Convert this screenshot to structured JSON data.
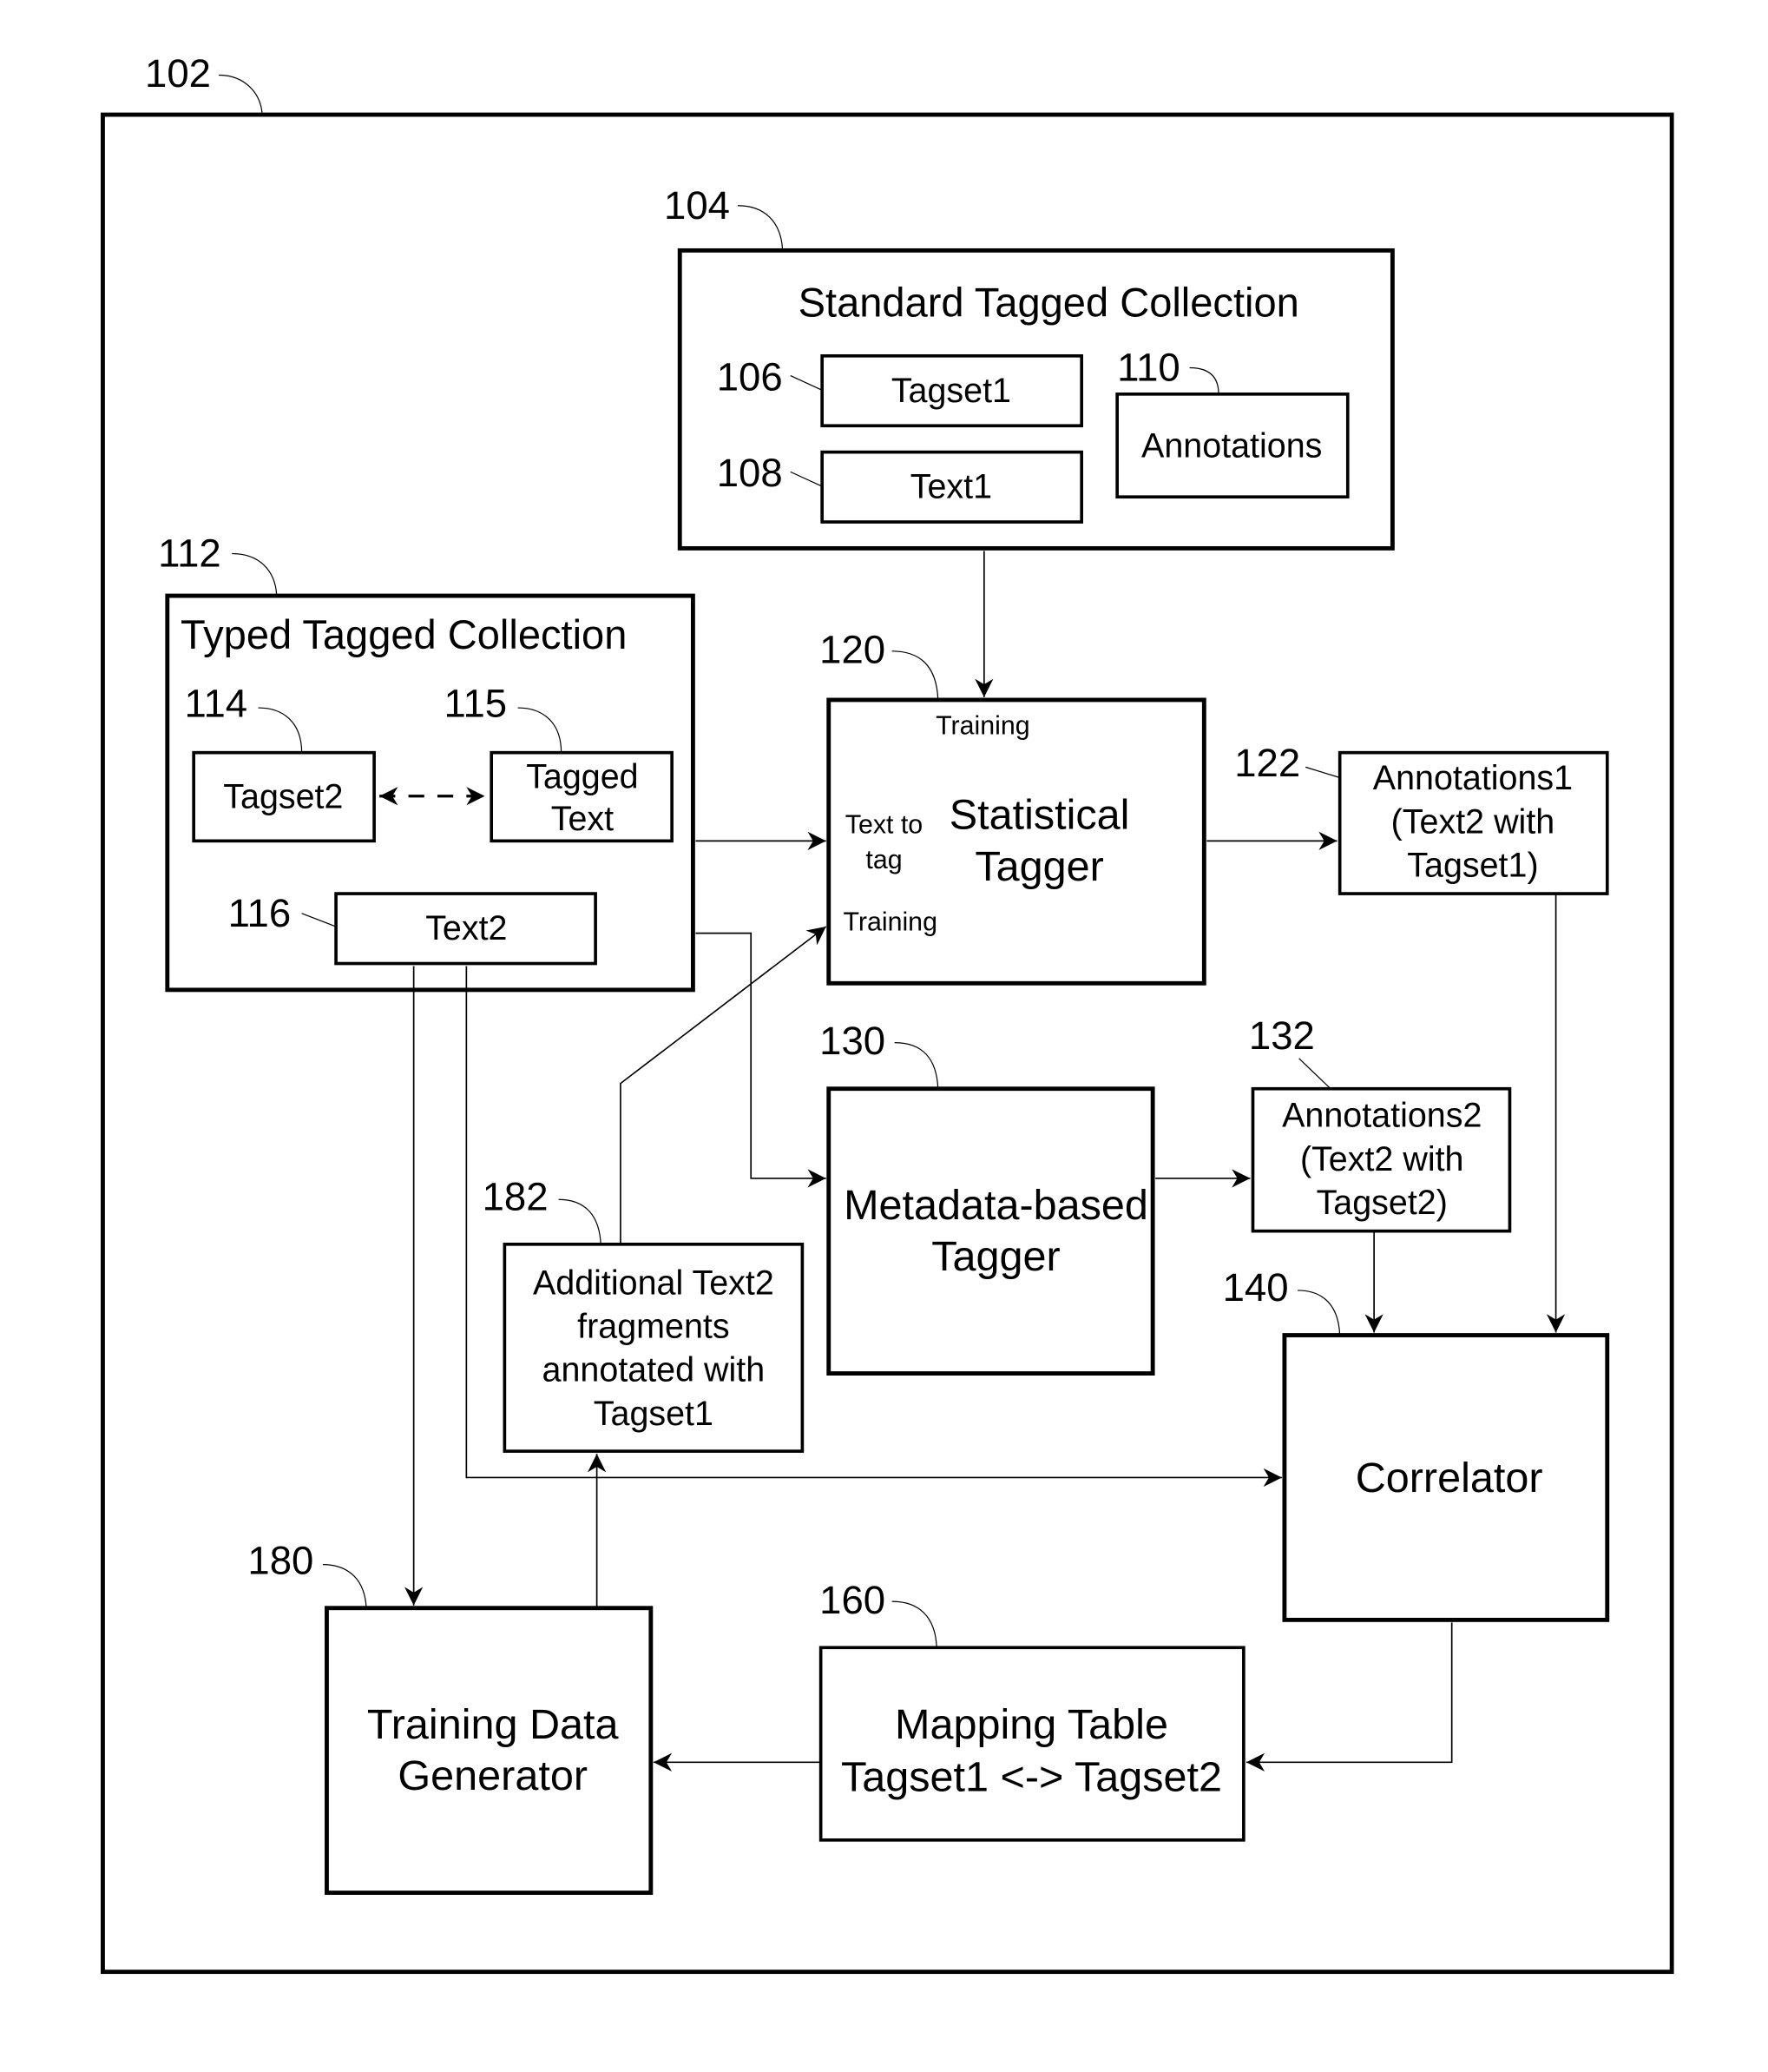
{
  "diagram": {
    "system": {
      "ref": "102"
    },
    "standard_collection": {
      "ref": "104",
      "title": "Standard  Tagged Collection",
      "tagset1": {
        "ref": "106",
        "label": "Tagset1"
      },
      "text1": {
        "ref": "108",
        "label": "Text1"
      },
      "annotations": {
        "ref": "110",
        "label": "Annotations"
      }
    },
    "typed_collection": {
      "ref": "112",
      "title": "Typed  Tagged Collection",
      "tagset2": {
        "ref": "114",
        "label": "Tagset2"
      },
      "tagged_text": {
        "ref": "115",
        "lines": [
          "Tagged",
          "Text"
        ]
      },
      "text2": {
        "ref": "116",
        "label": "Text2"
      }
    },
    "statistical_tagger": {
      "ref": "120",
      "lines": [
        "Statistical",
        "Tagger"
      ],
      "port_training_top": "Training",
      "port_text_to_tag": [
        "Text to",
        "tag"
      ],
      "port_training_left": "Training"
    },
    "annotations1": {
      "ref": "122",
      "lines": [
        "Annotations1",
        "(Text2 with",
        "Tagset1)"
      ]
    },
    "metadata_tagger": {
      "ref": "130",
      "lines": [
        "Metadata-based",
        "Tagger"
      ]
    },
    "annotations2": {
      "ref": "132",
      "lines": [
        "Annotations2",
        "(Text2 with",
        "Tagset2)"
      ]
    },
    "correlator": {
      "ref": "140",
      "label": "Correlator"
    },
    "mapping_table": {
      "ref": "160",
      "lines": [
        "Mapping Table",
        "Tagset1 <-> Tagset2"
      ]
    },
    "training_data_generator": {
      "ref": "180",
      "lines": [
        "Training Data",
        "Generator"
      ]
    },
    "additional_fragments": {
      "ref": "182",
      "lines": [
        "Additional Text2",
        "fragments",
        "annotated with",
        "Tagset1"
      ]
    }
  }
}
